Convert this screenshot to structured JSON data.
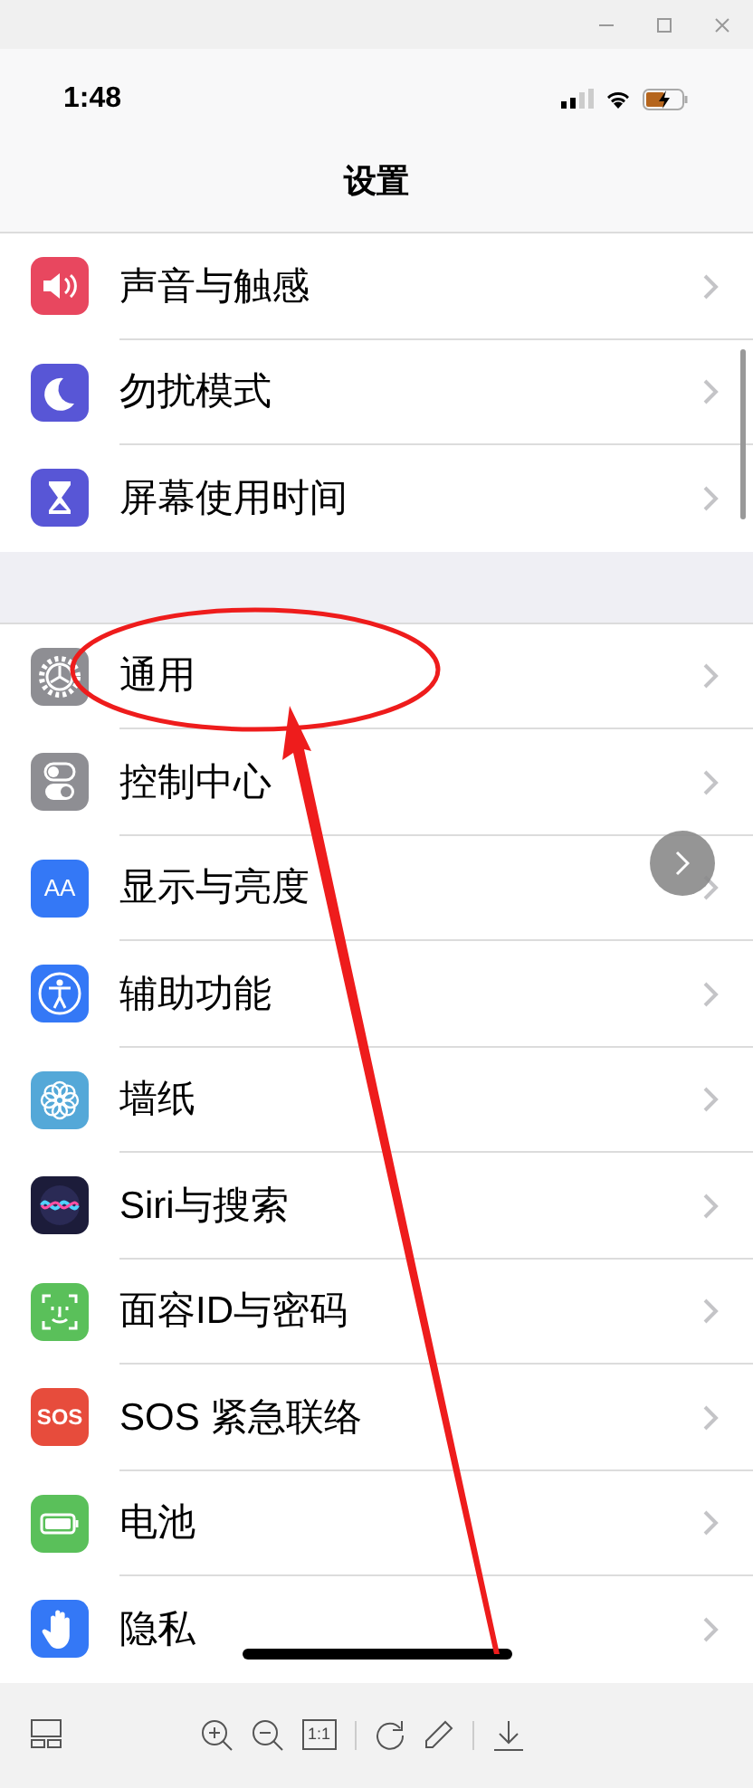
{
  "status_bar": {
    "time": "1:48"
  },
  "nav": {
    "title": "设置"
  },
  "sections": [
    [
      {
        "label": "声音与触感",
        "kind": "sound"
      },
      {
        "label": "勿扰模式",
        "kind": "moon"
      },
      {
        "label": "屏幕使用时间",
        "kind": "hourglass"
      }
    ],
    [
      {
        "label": "通用",
        "kind": "gear"
      },
      {
        "label": "控制中心",
        "kind": "toggles"
      },
      {
        "label": "显示与亮度",
        "kind": "textsize",
        "icon_text": "AA"
      },
      {
        "label": "辅助功能",
        "kind": "accessibility"
      },
      {
        "label": "墙纸",
        "kind": "flower"
      },
      {
        "label": "Siri与搜索",
        "kind": "siri"
      },
      {
        "label": "面容ID与密码",
        "kind": "face"
      },
      {
        "label": "SOS 紧急联络",
        "kind": "sos",
        "icon_text": "SOS"
      },
      {
        "label": "电池",
        "kind": "battery"
      },
      {
        "label": "隐私",
        "kind": "hand"
      }
    ]
  ],
  "toolbar": {
    "fit_button": "1:1"
  }
}
